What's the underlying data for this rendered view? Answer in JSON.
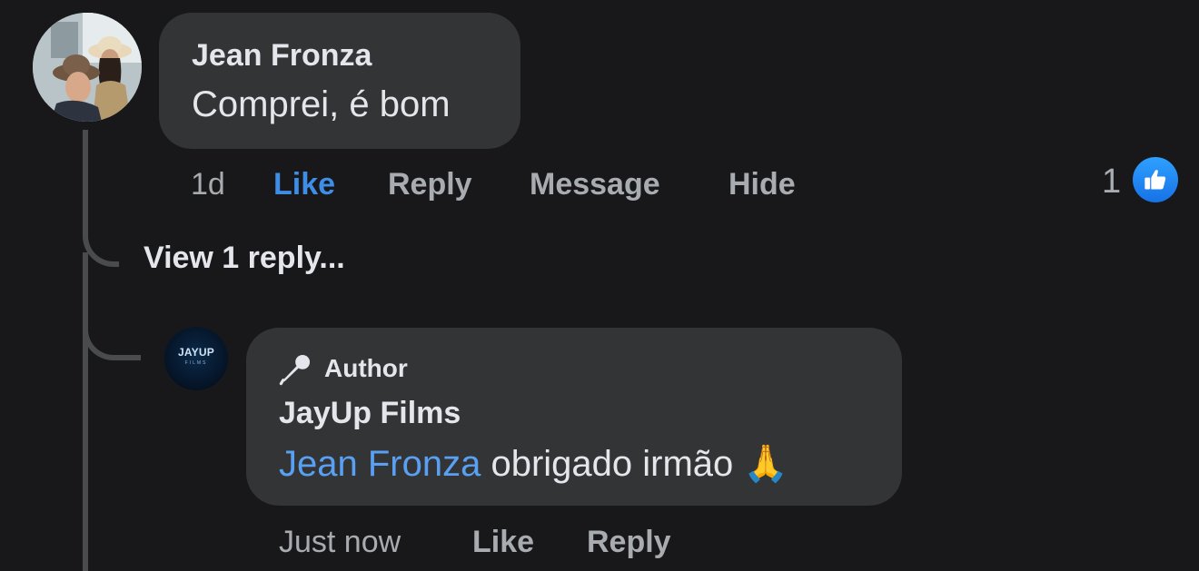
{
  "comment": {
    "author": "Jean Fronza",
    "text": "Comprei, é bom",
    "actions": {
      "time": "1d",
      "like": "Like",
      "reply": "Reply",
      "message": "Message",
      "hide": "Hide"
    },
    "reaction_count": "1",
    "reaction_type": "like-icon",
    "liked": true
  },
  "view_replies": "View 1 reply...",
  "reply": {
    "badge": "Author",
    "badge_icon": "microphone-icon",
    "author": "JayUp Films",
    "mention": "Jean Fronza",
    "text": " obrigado irmão 🙏",
    "avatar_logo": "JAYUP",
    "avatar_logo_sub": "FILMS",
    "actions": {
      "time": "Just now",
      "like": "Like",
      "reply": "Reply"
    }
  },
  "colors": {
    "background": "#18181a",
    "bubble": "#333436",
    "accent": "#3e8ee8",
    "mention": "#5aa0f2",
    "muted_text": "#a8abaf"
  }
}
